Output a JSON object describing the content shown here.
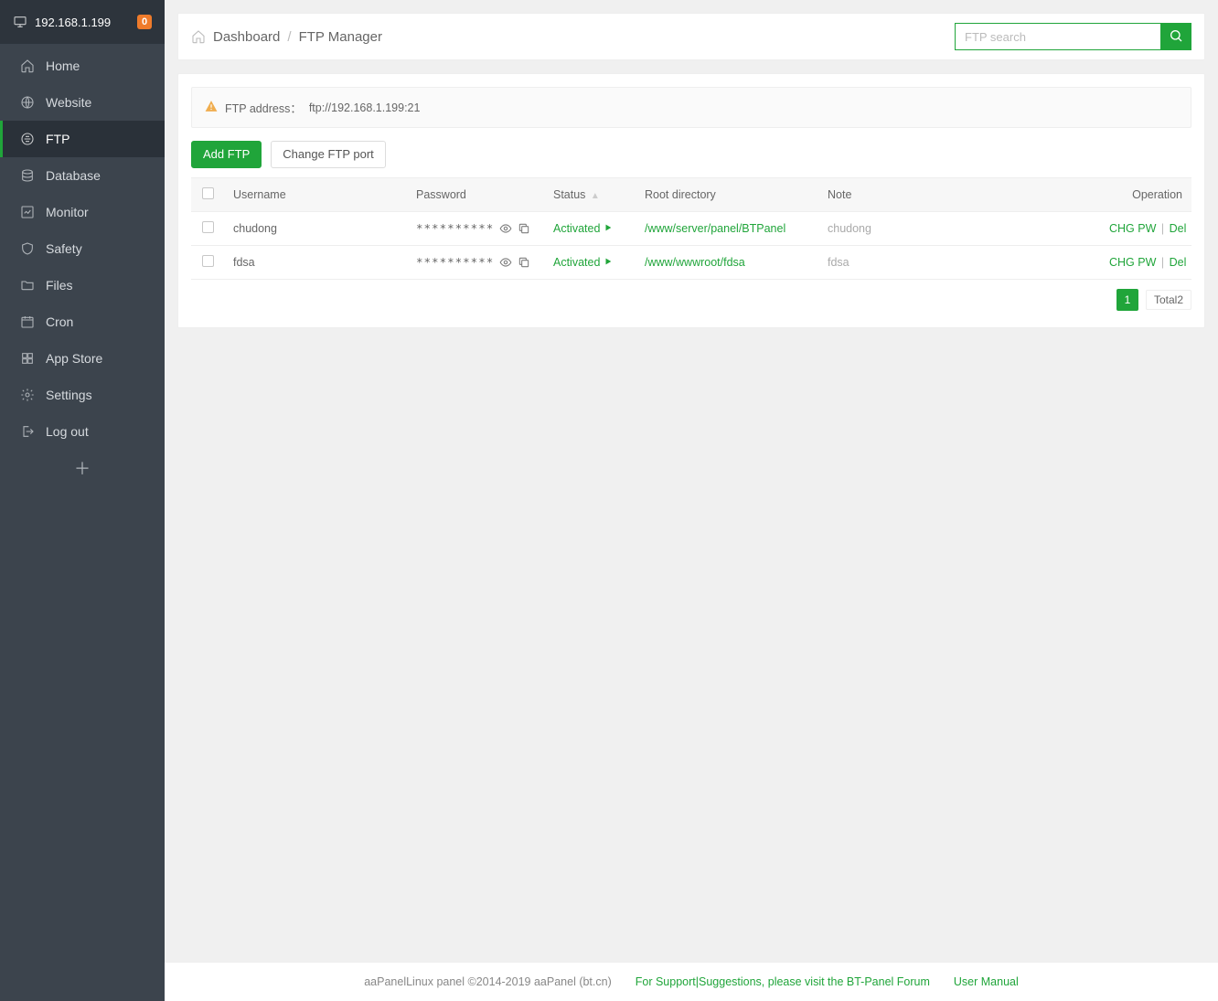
{
  "sidebar": {
    "ip": "192.168.1.199",
    "badge": "0",
    "items": [
      {
        "key": "home",
        "label": "Home"
      },
      {
        "key": "website",
        "label": "Website"
      },
      {
        "key": "ftp",
        "label": "FTP"
      },
      {
        "key": "database",
        "label": "Database"
      },
      {
        "key": "monitor",
        "label": "Monitor"
      },
      {
        "key": "safety",
        "label": "Safety"
      },
      {
        "key": "files",
        "label": "Files"
      },
      {
        "key": "cron",
        "label": "Cron"
      },
      {
        "key": "appstore",
        "label": "App Store"
      },
      {
        "key": "settings",
        "label": "Settings"
      },
      {
        "key": "logout",
        "label": "Log out"
      }
    ],
    "active_key": "ftp"
  },
  "header": {
    "breadcrumb": {
      "dashboard": "Dashboard",
      "current": "FTP Manager"
    },
    "search_placeholder": "FTP search"
  },
  "notice": {
    "label": "FTP address：",
    "value": "ftp://192.168.1.199:21"
  },
  "actions": {
    "add_ftp": "Add FTP",
    "change_port": "Change FTP port"
  },
  "table": {
    "headers": {
      "username": "Username",
      "password": "Password",
      "status": "Status",
      "root": "Root directory",
      "note": "Note",
      "operation": "Operation"
    },
    "password_mask": "**********",
    "status_label": "Activated",
    "op_chg_pw": "CHG PW",
    "op_del": "Del",
    "rows": [
      {
        "username": "chudong",
        "root": "/www/server/panel/BTPanel",
        "note": "chudong"
      },
      {
        "username": "fdsa",
        "root": "/www/wwwroot/fdsa",
        "note": "fdsa"
      }
    ]
  },
  "pager": {
    "current": "1",
    "total_label": "Total2"
  },
  "footer": {
    "copyright": "aaPanelLinux panel ©2014-2019 aaPanel (bt.cn)",
    "support": "For Support|Suggestions, please visit the BT-Panel Forum",
    "manual": "User Manual"
  }
}
